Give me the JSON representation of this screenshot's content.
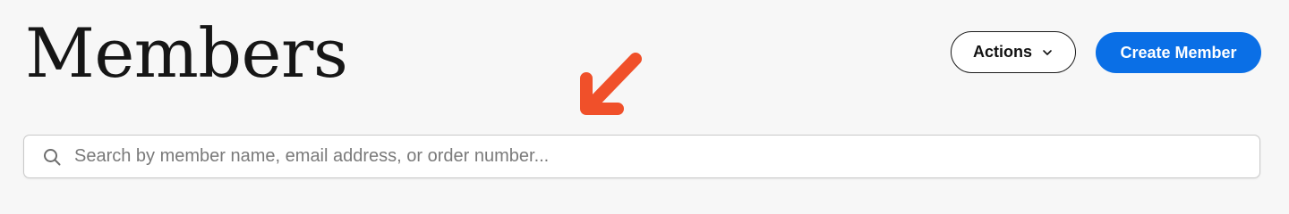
{
  "header": {
    "title": "Members",
    "actions_label": "Actions",
    "create_label": "Create Member"
  },
  "search": {
    "placeholder": "Search by member name, email address, or order number...",
    "value": ""
  },
  "icons": {
    "actions_chevron": "chevron-down-icon",
    "search": "search-icon",
    "annotation": "arrow-down-left-icon"
  },
  "colors": {
    "background": "#f7f7f7",
    "primary": "#0a6fe6",
    "annotation_arrow": "#f0502a",
    "title_text": "#161616"
  }
}
